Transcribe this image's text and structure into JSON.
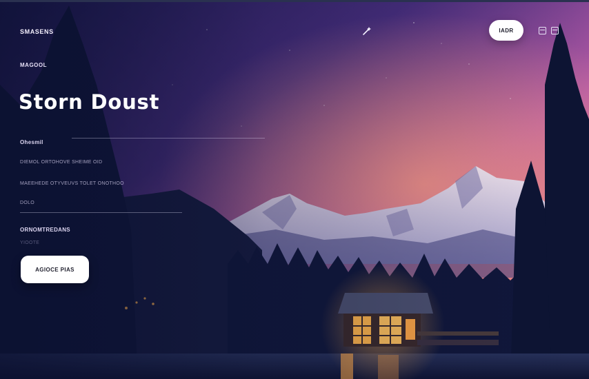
{
  "nav": {
    "brand": "SMASENS",
    "center_icon": "magic-wand-icon",
    "pill_label": "IADR",
    "right_icons": [
      "panel-icon",
      "layout-icon"
    ]
  },
  "hero": {
    "eyebrow": "MAGOOL",
    "title": "Storn Doust",
    "label_1": "Ohesmil",
    "body_line_1": "DIEMOL ORTOHOVE SHEIME OID",
    "body_line_2": "MAEEHEDE OTYVEUVS TOLET ONOTHOO",
    "input_value": "DOLO",
    "label_2": "ORNOMTREDANS",
    "hint": "YIOOTE",
    "cta_label": "AGIOCE PIAS"
  },
  "colors": {
    "sky_top": "#3d2f7a",
    "sky_mid": "#b75aa3",
    "sky_glow": "#f08a86",
    "forest": "#101634",
    "cabin_light": "#ffb14a",
    "button_bg": "#ffffff"
  }
}
